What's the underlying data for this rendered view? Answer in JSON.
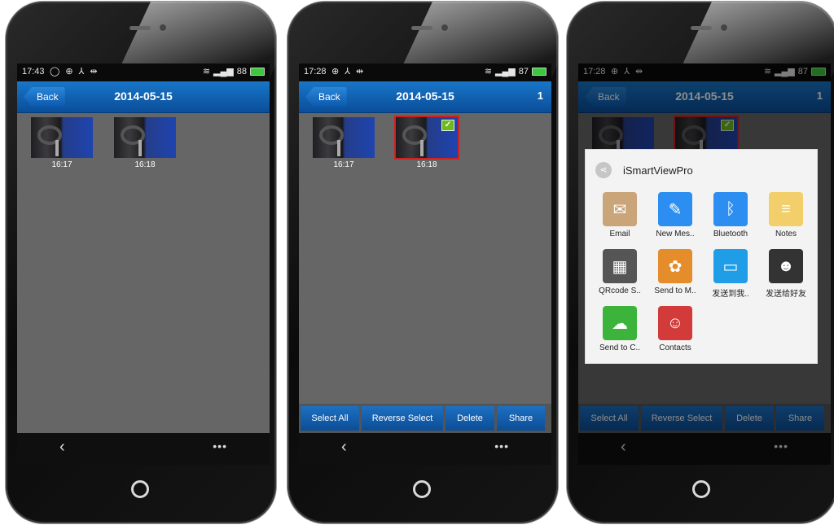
{
  "screens": [
    {
      "status": {
        "time": "17:43",
        "left_icons": "◯ ⊕ ⅄ ⇹",
        "battery": "88"
      },
      "header": {
        "back_label": "Back",
        "title": "2014-05-15",
        "count": ""
      },
      "photos": [
        {
          "time": "16:17",
          "selected": false
        },
        {
          "time": "16:18",
          "selected": false
        }
      ]
    },
    {
      "status": {
        "time": "17:28",
        "left_icons": "⊕ ⅄ ⇹",
        "battery": "87"
      },
      "header": {
        "back_label": "Back",
        "title": "2014-05-15",
        "count": "1"
      },
      "photos": [
        {
          "time": "16:17",
          "selected": false
        },
        {
          "time": "16:18",
          "selected": true
        }
      ],
      "actions": [
        "Select All",
        "Reverse Select",
        "Delete",
        "Share"
      ]
    },
    {
      "status": {
        "time": "17:28",
        "left_icons": "⊕ ⅄ ⇹",
        "battery": "87"
      },
      "header": {
        "back_label": "Back",
        "title": "2014-05-15",
        "count": "1"
      },
      "actions": [
        "Select All",
        "Reverse Select",
        "Delete",
        "Share"
      ],
      "share_dialog": {
        "title": "iSmartViewPro",
        "items": [
          {
            "label": "Email",
            "icon": "email-icon",
            "color": "#caa57a"
          },
          {
            "label": "New Mes..",
            "icon": "message-icon",
            "color": "#2b8ef0"
          },
          {
            "label": "Bluetooth",
            "icon": "bluetooth-icon",
            "color": "#2b8ef0"
          },
          {
            "label": "Notes",
            "icon": "notes-icon",
            "color": "#f2cf6a"
          },
          {
            "label": "QRcode S..",
            "icon": "qrcode-icon",
            "color": "#555555"
          },
          {
            "label": "Send to M..",
            "icon": "send-to-icon",
            "color": "#e58c2b"
          },
          {
            "label": "发送到我..",
            "icon": "computer-icon",
            "color": "#1f9de6"
          },
          {
            "label": "发送给好友",
            "icon": "qq-icon",
            "color": "#333333"
          },
          {
            "label": "Send to C..",
            "icon": "wechat-icon",
            "color": "#3cb43c"
          },
          {
            "label": "Contacts",
            "icon": "contacts-icon",
            "color": "#d33b3b"
          }
        ]
      }
    }
  ],
  "nav": {
    "back_symbol": "‹",
    "more_symbol": "•••"
  }
}
